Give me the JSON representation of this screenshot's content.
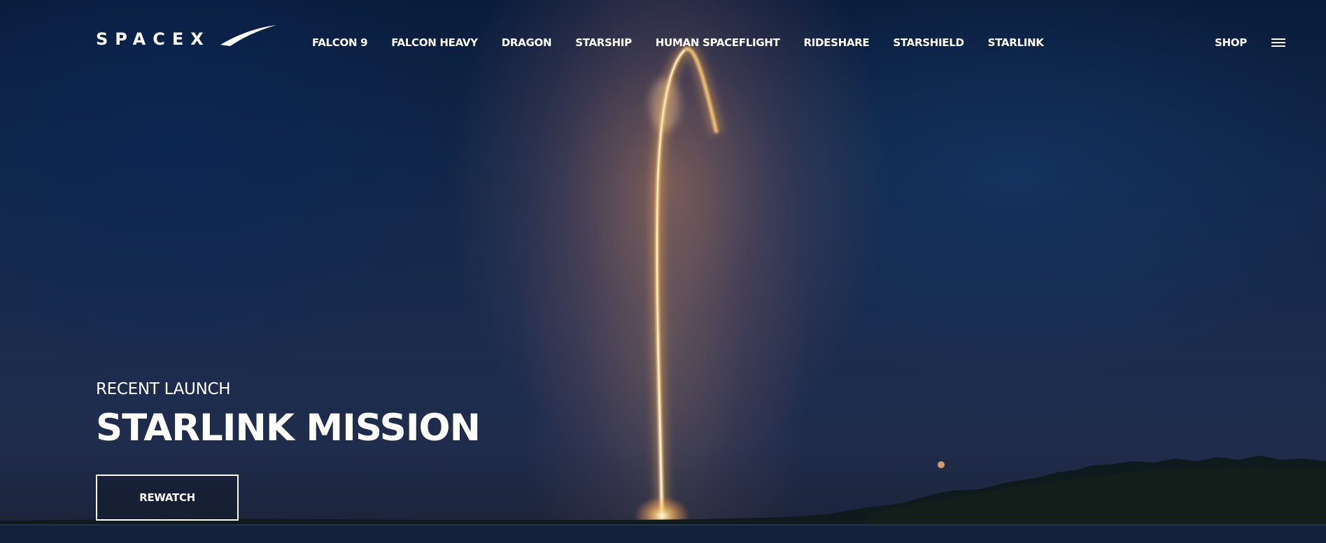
{
  "brand": {
    "logo_text": "SPACEX"
  },
  "nav": {
    "items": [
      {
        "label": "FALCON 9"
      },
      {
        "label": "FALCON HEAVY"
      },
      {
        "label": "DRAGON"
      },
      {
        "label": "STARSHIP"
      },
      {
        "label": "HUMAN SPACEFLIGHT"
      },
      {
        "label": "RIDESHARE"
      },
      {
        "label": "STARSHIELD"
      },
      {
        "label": "STARLINK"
      }
    ],
    "shop_label": "SHOP",
    "menu_icon": "hamburger-menu-icon"
  },
  "hero": {
    "eyebrow": "RECENT LAUNCH",
    "title": "STARLINK MISSION",
    "cta_label": "REWATCH",
    "background": "rocket-launch-night-sky-photo"
  },
  "colors": {
    "text": "#ffffff",
    "sky_top": "#0a1c3c",
    "sky_bottom": "#1a2236",
    "exhaust": "#ffd27a"
  }
}
